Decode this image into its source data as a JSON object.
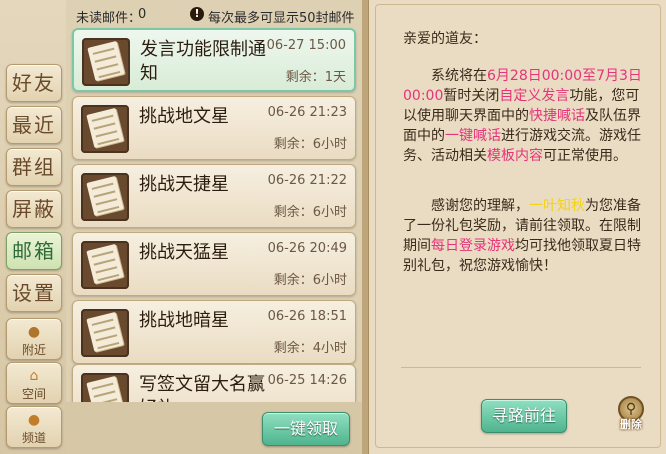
{
  "tabs": [
    {
      "label": "好友",
      "active": false
    },
    {
      "label": "最近",
      "active": false
    },
    {
      "label": "群组",
      "active": false
    },
    {
      "label": "屏蔽",
      "active": false
    },
    {
      "label": "邮箱",
      "active": true
    },
    {
      "label": "设置",
      "active": false
    }
  ],
  "icon_tabs": [
    {
      "label": "附近",
      "icon": "person-pin-icon"
    },
    {
      "label": "空间",
      "icon": "house-icon"
    },
    {
      "label": "频道",
      "icon": "chat-bubble-icon"
    }
  ],
  "list_header": {
    "unread_label": "未读邮件：",
    "unread_count": "0",
    "limit_note": "每次最多可显示50封邮件"
  },
  "mails": [
    {
      "title": "发言功能限制通知",
      "date": "06-27 15:00",
      "remaining": "剩余：1天",
      "selected": true
    },
    {
      "title": "挑战地文星",
      "date": "06-26 21:23",
      "remaining": "剩余：6小时"
    },
    {
      "title": "挑战天捷星",
      "date": "06-26 21:22",
      "remaining": "剩余：6小时"
    },
    {
      "title": "挑战天猛星",
      "date": "06-26 20:49",
      "remaining": "剩余：6小时"
    },
    {
      "title": "挑战地暗星",
      "date": "06-26 18:51",
      "remaining": "剩余：4小时"
    },
    {
      "title": "写签文留大名赢好礼",
      "date": "06-25 14:26",
      "remaining": ""
    }
  ],
  "buttons": {
    "claim_all": "一键领取",
    "goto": "寻路前往",
    "delete": "删除"
  },
  "detail": {
    "greeting": "亲爱的道友：",
    "p1": [
      {
        "t": "系统将在"
      },
      {
        "t": "6月28日00:00至7月3日00:00",
        "c": "hl"
      },
      {
        "t": "暂时关闭"
      },
      {
        "t": "自定义发言",
        "c": "hl"
      },
      {
        "t": "功能，您可以使用聊天界面中的"
      },
      {
        "t": "快捷喊话",
        "c": "hl"
      },
      {
        "t": "及队伍界面中的"
      },
      {
        "t": "一键喊话",
        "c": "hl"
      },
      {
        "t": "进行游戏交流。游戏任务、活动相关"
      },
      {
        "t": "模板内容",
        "c": "hl"
      },
      {
        "t": "可正常使用。"
      }
    ],
    "p2": [
      {
        "t": "感谢您的理解，"
      },
      {
        "t": "一叶知秋",
        "c": "hy"
      },
      {
        "t": "为您准备了一份礼包奖励，请前往领取。在限制期间"
      },
      {
        "t": "每日登录游戏",
        "c": "hl"
      },
      {
        "t": "均可找他领取夏日特别礼包，祝您游戏愉快！"
      }
    ]
  },
  "colors": {
    "highlight_pink": "#e6337a",
    "highlight_yellow": "#f2d21a",
    "accent_green": "#4fb48e"
  }
}
